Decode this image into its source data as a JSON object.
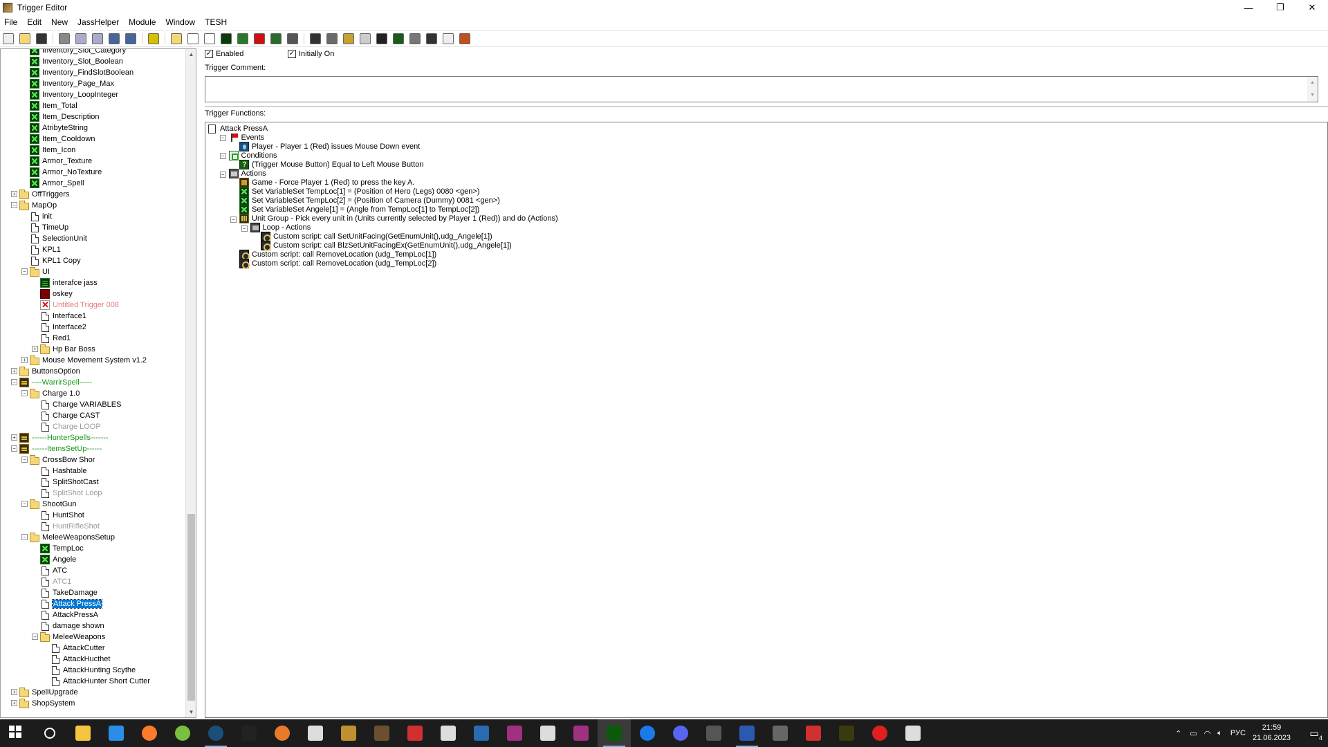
{
  "window": {
    "title": "Trigger Editor",
    "minimize": "—",
    "maximize": "❐",
    "close": "✕"
  },
  "menu": [
    "File",
    "Edit",
    "New",
    "JassHelper",
    "Module",
    "Window",
    "TESH"
  ],
  "toolbar_icons": [
    "new-icon",
    "open-icon",
    "save-icon",
    "cut-icon",
    "copy-icon",
    "paste-icon",
    "undo-icon",
    "redo-icon",
    "delete-icon",
    "new-category-icon",
    "new-trigger-icon",
    "new-comment-icon",
    "new-variable-icon",
    "variables-icon",
    "new-event-icon",
    "new-condition-icon",
    "new-action-icon",
    "test-map-icon",
    "terrain-editor-icon",
    "unit-editor-icon",
    "sound-editor-icon",
    "object-editor-icon",
    "campaign-editor-icon",
    "ai-editor-icon",
    "object-manager-icon",
    "import-manager-icon",
    "test-icon"
  ],
  "tree": [
    {
      "label": "Inventory_Slot_Category",
      "icon": "var",
      "level": 2
    },
    {
      "label": "Inventory_Slot_Boolean",
      "icon": "var",
      "level": 2
    },
    {
      "label": "Inventory_FindSlotBoolean",
      "icon": "var",
      "level": 2
    },
    {
      "label": "Inventory_Page_Max",
      "icon": "var",
      "level": 2
    },
    {
      "label": "Inventory_LoopInteger",
      "icon": "var",
      "level": 2
    },
    {
      "label": "Item_Total",
      "icon": "var",
      "level": 2
    },
    {
      "label": "Item_Description",
      "icon": "var",
      "level": 2
    },
    {
      "label": "AtribyteString",
      "icon": "var",
      "level": 2
    },
    {
      "label": "Item_Cooldown",
      "icon": "var",
      "level": 2
    },
    {
      "label": "Item_Icon",
      "icon": "var",
      "level": 2
    },
    {
      "label": "Armor_Texture",
      "icon": "var",
      "level": 2
    },
    {
      "label": "Armor_NoTexture",
      "icon": "var",
      "level": 2
    },
    {
      "label": "Armor_Spell",
      "icon": "var",
      "level": 2
    },
    {
      "label": "OffTriggers",
      "icon": "folder",
      "level": 1,
      "exp": "+"
    },
    {
      "label": "MapOp",
      "icon": "folder",
      "level": 1,
      "exp": "−"
    },
    {
      "label": "init",
      "icon": "doc",
      "level": 2
    },
    {
      "label": "TimeUp",
      "icon": "doc",
      "level": 2
    },
    {
      "label": "SelectionUnit",
      "icon": "doc",
      "level": 2
    },
    {
      "label": "KPL1",
      "icon": "doc",
      "level": 2
    },
    {
      "label": "KPL1 Copy",
      "icon": "doc",
      "level": 2
    },
    {
      "label": "UI",
      "icon": "folder",
      "level": 2,
      "exp": "−"
    },
    {
      "label": "interafce jass",
      "icon": "jass",
      "level": 3
    },
    {
      "label": "oskey",
      "icon": "red",
      "level": 3
    },
    {
      "label": "Untitled Trigger 008",
      "icon": "err",
      "level": 3,
      "style": "err"
    },
    {
      "label": "Interface1",
      "icon": "doc",
      "level": 3
    },
    {
      "label": "Interface2",
      "icon": "doc",
      "level": 3
    },
    {
      "label": "Red1",
      "icon": "doc",
      "level": 3
    },
    {
      "label": "Hp Bar Boss",
      "icon": "folder",
      "level": 3,
      "exp": "+"
    },
    {
      "label": "Mouse Movement System v1.2",
      "icon": "folder",
      "level": 2,
      "exp": "+"
    },
    {
      "label": "ButtonsOption",
      "icon": "folder",
      "level": 1,
      "exp": "+"
    },
    {
      "label": "----WarrirSpell-----",
      "icon": "cat",
      "level": 1,
      "exp": "−",
      "style": "grn"
    },
    {
      "label": "Charge 1.0",
      "icon": "folder",
      "level": 2,
      "exp": "−"
    },
    {
      "label": "Charge VARIABLES",
      "icon": "doc",
      "level": 3
    },
    {
      "label": "Charge CAST",
      "icon": "doc",
      "level": 3
    },
    {
      "label": "Charge LOOP",
      "icon": "doc",
      "level": 3,
      "style": "dis"
    },
    {
      "label": "------HunterSpells-------",
      "icon": "cat",
      "level": 1,
      "exp": "+",
      "style": "grn"
    },
    {
      "label": "------ItemsSetUp------",
      "icon": "cat",
      "level": 1,
      "exp": "−",
      "style": "grn"
    },
    {
      "label": "CrossBow Shor",
      "icon": "folder",
      "level": 2,
      "exp": "−"
    },
    {
      "label": "Hashtable",
      "icon": "doc",
      "level": 3
    },
    {
      "label": "SplitShotCast",
      "icon": "doc",
      "level": 3
    },
    {
      "label": "SplitShot Loop",
      "icon": "doc",
      "level": 3,
      "style": "dis"
    },
    {
      "label": "ShootGun",
      "icon": "folder",
      "level": 2,
      "exp": "−"
    },
    {
      "label": "HuntShot",
      "icon": "doc",
      "level": 3
    },
    {
      "label": "HuntRifleShot",
      "icon": "doc",
      "level": 3,
      "style": "dis"
    },
    {
      "label": "MeleeWeaponsSetup",
      "icon": "folder",
      "level": 2,
      "exp": "−"
    },
    {
      "label": "TempLoc",
      "icon": "var",
      "level": 3
    },
    {
      "label": "Angele",
      "icon": "var",
      "level": 3
    },
    {
      "label": "ATC",
      "icon": "doc",
      "level": 3
    },
    {
      "label": "ATC1",
      "icon": "doc",
      "level": 3,
      "style": "dis"
    },
    {
      "label": "TakeDamage",
      "icon": "doc",
      "level": 3
    },
    {
      "label": "Attack PressA",
      "icon": "doc",
      "level": 3,
      "style": "sel"
    },
    {
      "label": "AttackPressA",
      "icon": "doc",
      "level": 3
    },
    {
      "label": "damage shown",
      "icon": "doc",
      "level": 3
    },
    {
      "label": "MeleeWeapons",
      "icon": "folder",
      "level": 3,
      "exp": "−"
    },
    {
      "label": "AttackCutter",
      "icon": "doc",
      "level": 4
    },
    {
      "label": "AttackHucthet",
      "icon": "doc",
      "level": 4
    },
    {
      "label": "AttackHunting Scythe",
      "icon": "doc",
      "level": 4
    },
    {
      "label": "AttackHunter Short Cutter",
      "icon": "doc",
      "level": 4
    },
    {
      "label": "SpellUpgrade",
      "icon": "folder",
      "level": 1,
      "exp": "+"
    },
    {
      "label": "ShopSystem",
      "icon": "folder",
      "level": 1,
      "exp": "+"
    }
  ],
  "editor": {
    "enabled_label": "Enabled",
    "initially_on_label": "Initially On",
    "comment_label": "Trigger Comment:",
    "comment_value": "",
    "functions_label": "Trigger Functions:"
  },
  "functions": [
    {
      "text": "Attack PressA",
      "icon": "doc",
      "level": 0
    },
    {
      "text": "Events",
      "icon": "flag",
      "level": 1,
      "exp": "−"
    },
    {
      "text": "Player - Player 1 (Red) issues Mouse Down event",
      "icon": "mouse",
      "level": 2
    },
    {
      "text": "Conditions",
      "icon": "cond",
      "level": 1,
      "exp": "−"
    },
    {
      "text": "(Trigger Mouse Button) Equal to Left Mouse Button",
      "icon": "q",
      "level": 2
    },
    {
      "text": "Actions",
      "icon": "act",
      "level": 1,
      "exp": "−"
    },
    {
      "text": "Game - Force Player 1 (Red) to press the key A.",
      "icon": "game",
      "level": 2
    },
    {
      "text": "Set VariableSet TempLoc[1] = (Position of Hero (Legs) 0080 <gen>)",
      "icon": "setv",
      "level": 2
    },
    {
      "text": "Set VariableSet TempLoc[2] = (Position of Camera (Dummy) 0081 <gen>)",
      "icon": "setv",
      "level": 2
    },
    {
      "text": "Set VariableSet Angele[1] = (Angle from TempLoc[1] to TempLoc[2])",
      "icon": "setv",
      "level": 2
    },
    {
      "text": "Unit Group - Pick every unit in (Units currently selected by Player 1 (Red)) and do (Actions)",
      "icon": "grp",
      "level": 2,
      "exp": "−"
    },
    {
      "text": "Loop - Actions",
      "icon": "loop",
      "level": 3,
      "exp": "−"
    },
    {
      "text": "Custom script:   call SetUnitFacing(GetEnumUnit(),udg_Angele[1])",
      "icon": "script",
      "level": 4
    },
    {
      "text": "Custom script:   call BlzSetUnitFacingEx(GetEnumUnit(),udg_Angele[1])",
      "icon": "script",
      "level": 4
    },
    {
      "text": "Custom script:   call RemoveLocation (udg_TempLoc[1])",
      "icon": "script",
      "level": 2
    },
    {
      "text": "Custom script:   call RemoveLocation (udg_TempLoc[2])",
      "icon": "script",
      "level": 2
    }
  ],
  "taskbar": {
    "apps": [
      "start-icon",
      "search-icon",
      "explorer-icon",
      "mail-icon",
      "firefox-icon",
      "utorrent-icon",
      "steam-icon",
      "epic-games-icon",
      "blender-icon",
      "notepad-icon",
      "warcraft-icon",
      "game-icon",
      "paint-icon",
      "terminal-icon",
      "vpn-icon",
      "app-icon",
      "app2-icon",
      "app3-icon",
      "world-editor-icon",
      "edge-icon",
      "discord-icon",
      "app4-icon",
      "save-app-icon",
      "app5-icon",
      "git-icon",
      "binary-icon",
      "opera-icon",
      "flask-icon"
    ],
    "lang": "РУС",
    "time": "21:59",
    "date": "21.06.2023",
    "notifications": "4"
  }
}
